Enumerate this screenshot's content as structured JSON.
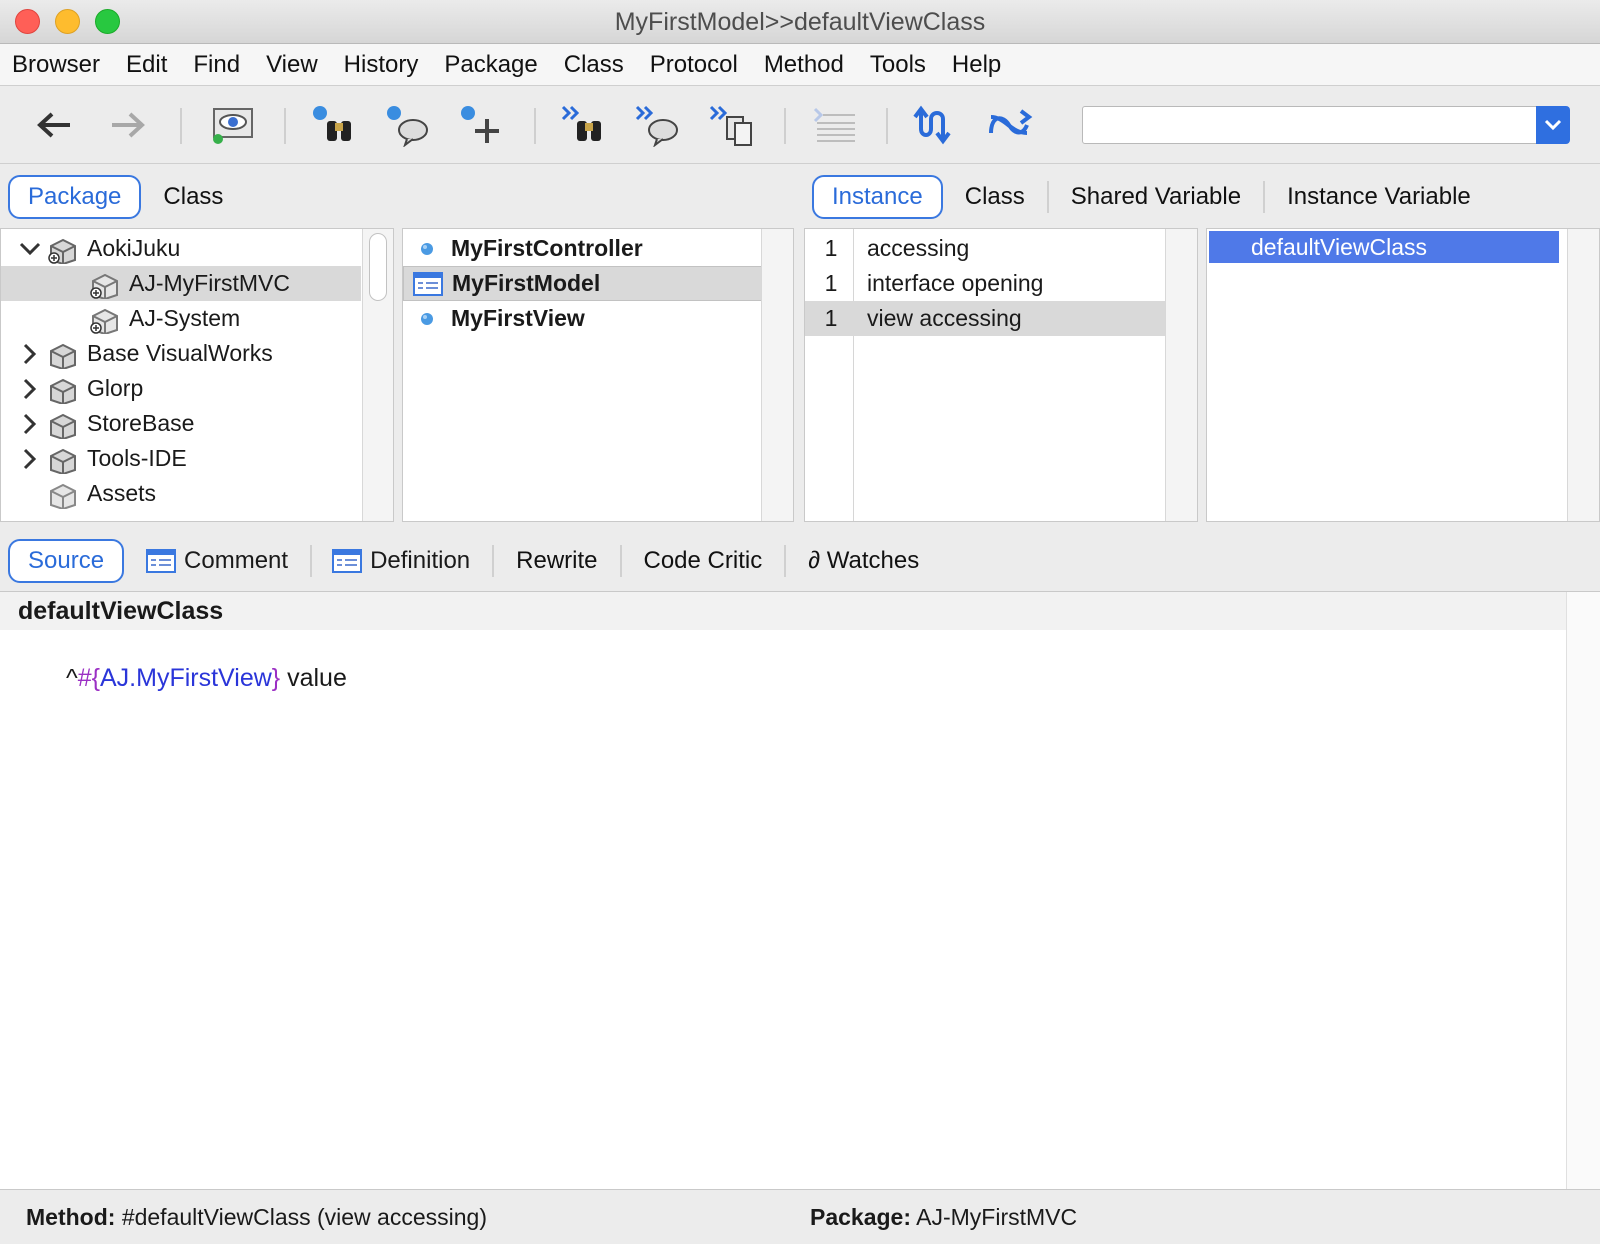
{
  "window": {
    "title": "MyFirstModel>>defaultViewClass"
  },
  "menu": [
    "Browser",
    "Edit",
    "Find",
    "View",
    "History",
    "Package",
    "Class",
    "Protocol",
    "Method",
    "Tools",
    "Help"
  ],
  "toolbar": {
    "search": {
      "value": "",
      "placeholder": ""
    }
  },
  "nav_tabs": {
    "left": {
      "package": "Package",
      "class": "Class"
    },
    "right": {
      "instance": "Instance",
      "class": "Class",
      "shared_variable": "Shared Variable",
      "instance_variable": "Instance Variable"
    }
  },
  "packages": [
    {
      "label": "AokiJuku",
      "expanded": true
    },
    {
      "label": "AJ-MyFirstMVC"
    },
    {
      "label": "AJ-System"
    },
    {
      "label": "Base VisualWorks"
    },
    {
      "label": "Glorp"
    },
    {
      "label": "StoreBase"
    },
    {
      "label": "Tools-IDE"
    },
    {
      "label": "Assets"
    }
  ],
  "classes": [
    "MyFirstController",
    "MyFirstModel",
    "MyFirstView"
  ],
  "protocols": [
    {
      "count": "1",
      "name": "accessing"
    },
    {
      "count": "1",
      "name": "interface opening"
    },
    {
      "count": "1",
      "name": "view accessing"
    }
  ],
  "methods": [
    "defaultViewClass"
  ],
  "code_tabs": {
    "source": "Source",
    "comment": "Comment",
    "definition": "Definition",
    "rewrite": "Rewrite",
    "code_critic": "Code Critic",
    "watches": "∂ Watches"
  },
  "source": {
    "method_name": "defaultViewClass",
    "code": {
      "caret": "^",
      "hash": "#",
      "open": "{",
      "ref": "AJ.MyFirstView",
      "close": "}",
      "rest": " value"
    }
  },
  "status": {
    "method_label": "Method:",
    "method_value": "#defaultViewClass (view accessing)",
    "package_label": "Package:",
    "package_value": "AJ-MyFirstMVC"
  },
  "colors": {
    "accent": "#3a78e0",
    "selection": "#4f79e8",
    "code_hash": "#9b2fc4",
    "code_ref": "#2a35d9"
  }
}
